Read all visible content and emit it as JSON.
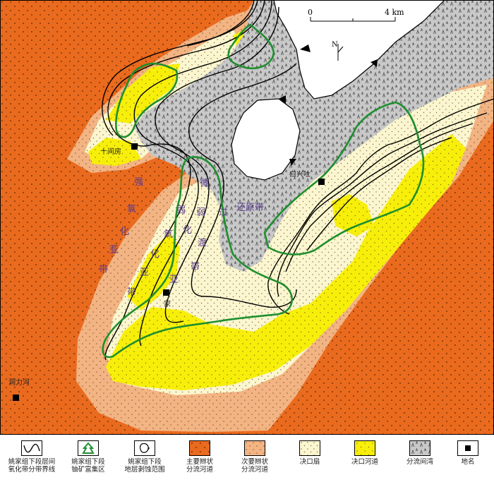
{
  "scale_bar": {
    "start_label": "0",
    "end_label": "4 km"
  },
  "north_arrow": {
    "label": "N"
  },
  "places": [
    {
      "name": "十间房"
    },
    {
      "name": "白兴吐"
    },
    {
      "name": "家"
    },
    {
      "name": "洞力河"
    }
  ],
  "zone_labels": {
    "strong_oxidation": [
      "强",
      "氧",
      "化",
      "亚",
      "带"
    ],
    "weak_oxidation": [
      "弱",
      "氧",
      "化",
      "亚",
      "带"
    ],
    "transition": [
      "微",
      "弱",
      "过",
      "渡",
      "带"
    ],
    "weak_reduction": "还原带"
  },
  "legend": [
    {
      "label": "姚家组下段层间\n氧化带分带界线",
      "type": "line-boundary"
    },
    {
      "label": "姚家组下段\n铀矿富集区",
      "type": "uranium-zone",
      "color": "#1f8f2e"
    },
    {
      "label": "姚家组下段\n地层剥蚀范围",
      "type": "erosion"
    },
    {
      "label": "主要辫状\n分流河道",
      "type": "fill",
      "color": "#ea6a1e"
    },
    {
      "label": "次要辫状\n分流河道",
      "type": "fill",
      "color": "#f3b483"
    },
    {
      "label": "决口扇",
      "type": "fill",
      "color": "#fbf6cf"
    },
    {
      "label": "决口河道",
      "type": "fill",
      "color": "#f7ef0a"
    },
    {
      "label": "分流间湾",
      "type": "fill",
      "color": "#c8c8c8"
    },
    {
      "label": "地名",
      "type": "place"
    }
  ],
  "colors": {
    "main_channel": "#ea6a1e",
    "secondary_channel": "#f3b483",
    "crevasse_splay": "#fbf6cf",
    "crevasse_channel": "#f7ef0a",
    "interdistributary_bay": "#c8c8c8",
    "uranium_zone": "#1f8f2e",
    "zone_label": "#5a3c8c"
  }
}
